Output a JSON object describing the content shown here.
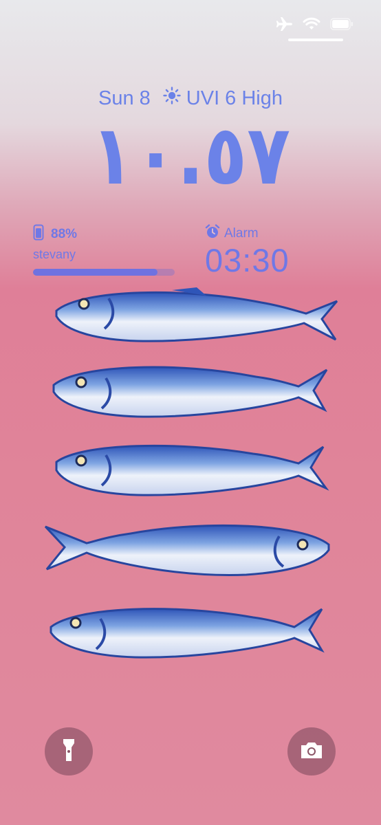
{
  "status_bar": {
    "icons": [
      "airplane-icon",
      "wifi-icon",
      "battery-icon"
    ]
  },
  "date_line": {
    "date": "Sun 8",
    "weather_icon": "sun-icon",
    "uv": "UVI 6 High"
  },
  "clock": {
    "time": "١٠.٥٧"
  },
  "battery_widget": {
    "percent_text": "88%",
    "percent_value": 0.88,
    "device_name": "stevany",
    "icon": "phone-battery-icon"
  },
  "alarm_widget": {
    "label": "Alarm",
    "time": "03:30",
    "icon": "alarm-clock-icon"
  },
  "wallpaper": {
    "subject": "painted-sardines",
    "fish_count": 5
  },
  "bottom_controls": {
    "left": "flashlight-icon",
    "right": "camera-icon"
  },
  "colors": {
    "accent": "#6b82e8",
    "widget_text": "#6f78e6",
    "background_pink": "#e0849a",
    "fish_blue": "#3b5fc0",
    "fish_white": "#eef2fa"
  }
}
